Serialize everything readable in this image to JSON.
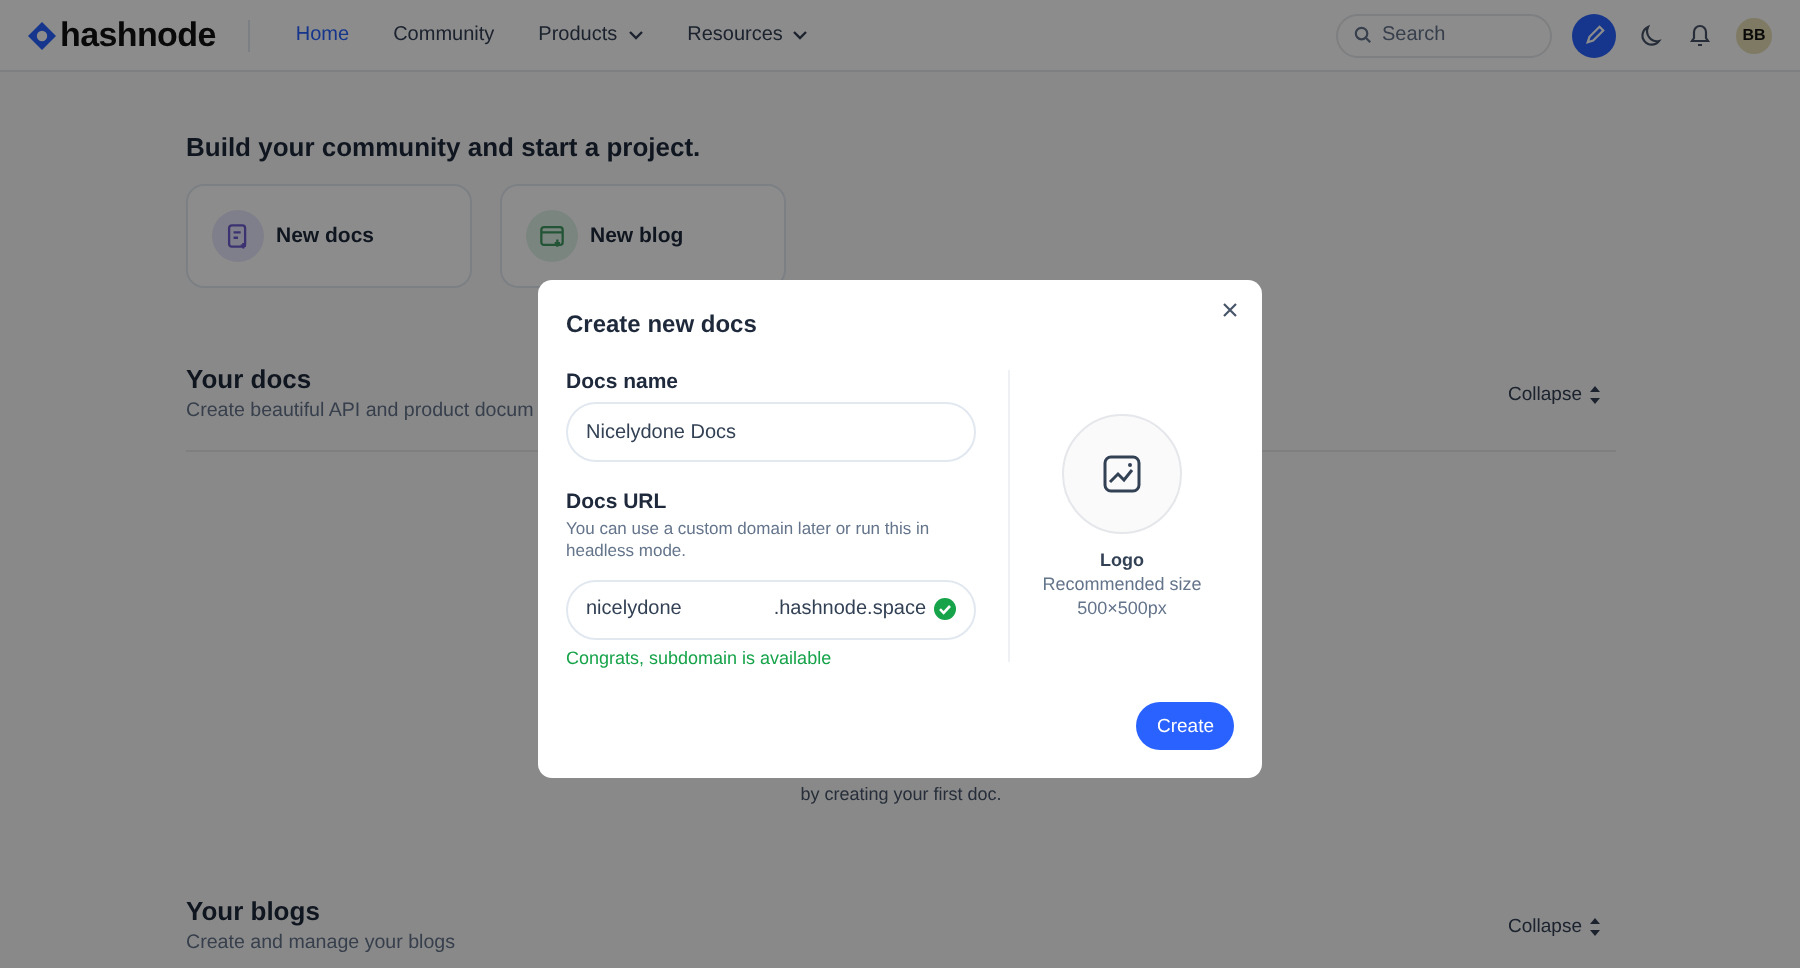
{
  "header": {
    "logo": "hashnode",
    "nav": [
      {
        "label": "Home",
        "selected": true,
        "dropdown": false
      },
      {
        "label": "Community",
        "selected": false,
        "dropdown": false
      },
      {
        "label": "Products",
        "selected": false,
        "dropdown": true
      },
      {
        "label": "Resources",
        "selected": false,
        "dropdown": true
      }
    ],
    "search": {
      "placeholder": "Search"
    },
    "avatar": "BB"
  },
  "intro": {
    "title": "Build your community and start a project.",
    "cards": [
      {
        "label": "New docs",
        "kind": "docs"
      },
      {
        "label": "New blog",
        "kind": "blog"
      }
    ]
  },
  "sections": [
    {
      "title": "Your docs",
      "description": "Create beautiful API and product docum",
      "action": "Collapse",
      "empty_text": "by creating your first doc."
    },
    {
      "title": "Your blogs",
      "description": "Create and manage your blogs",
      "action": "Collapse"
    }
  ],
  "modal": {
    "title": "Create new docs",
    "fields": [
      {
        "kind": "text",
        "label": "Docs name",
        "value": "Nicelydone Docs"
      },
      {
        "kind": "subdomain",
        "label": "Docs URL",
        "help": "You can use a custom domain later or run this in headless mode.",
        "value": "nicelydone",
        "suffix": ".hashnode.space",
        "valid": true,
        "message": "Congrats, subdomain is available"
      }
    ],
    "logo": {
      "label": "Logo",
      "hint": "Recommended size",
      "size": "500×500px"
    },
    "button": "Create"
  }
}
